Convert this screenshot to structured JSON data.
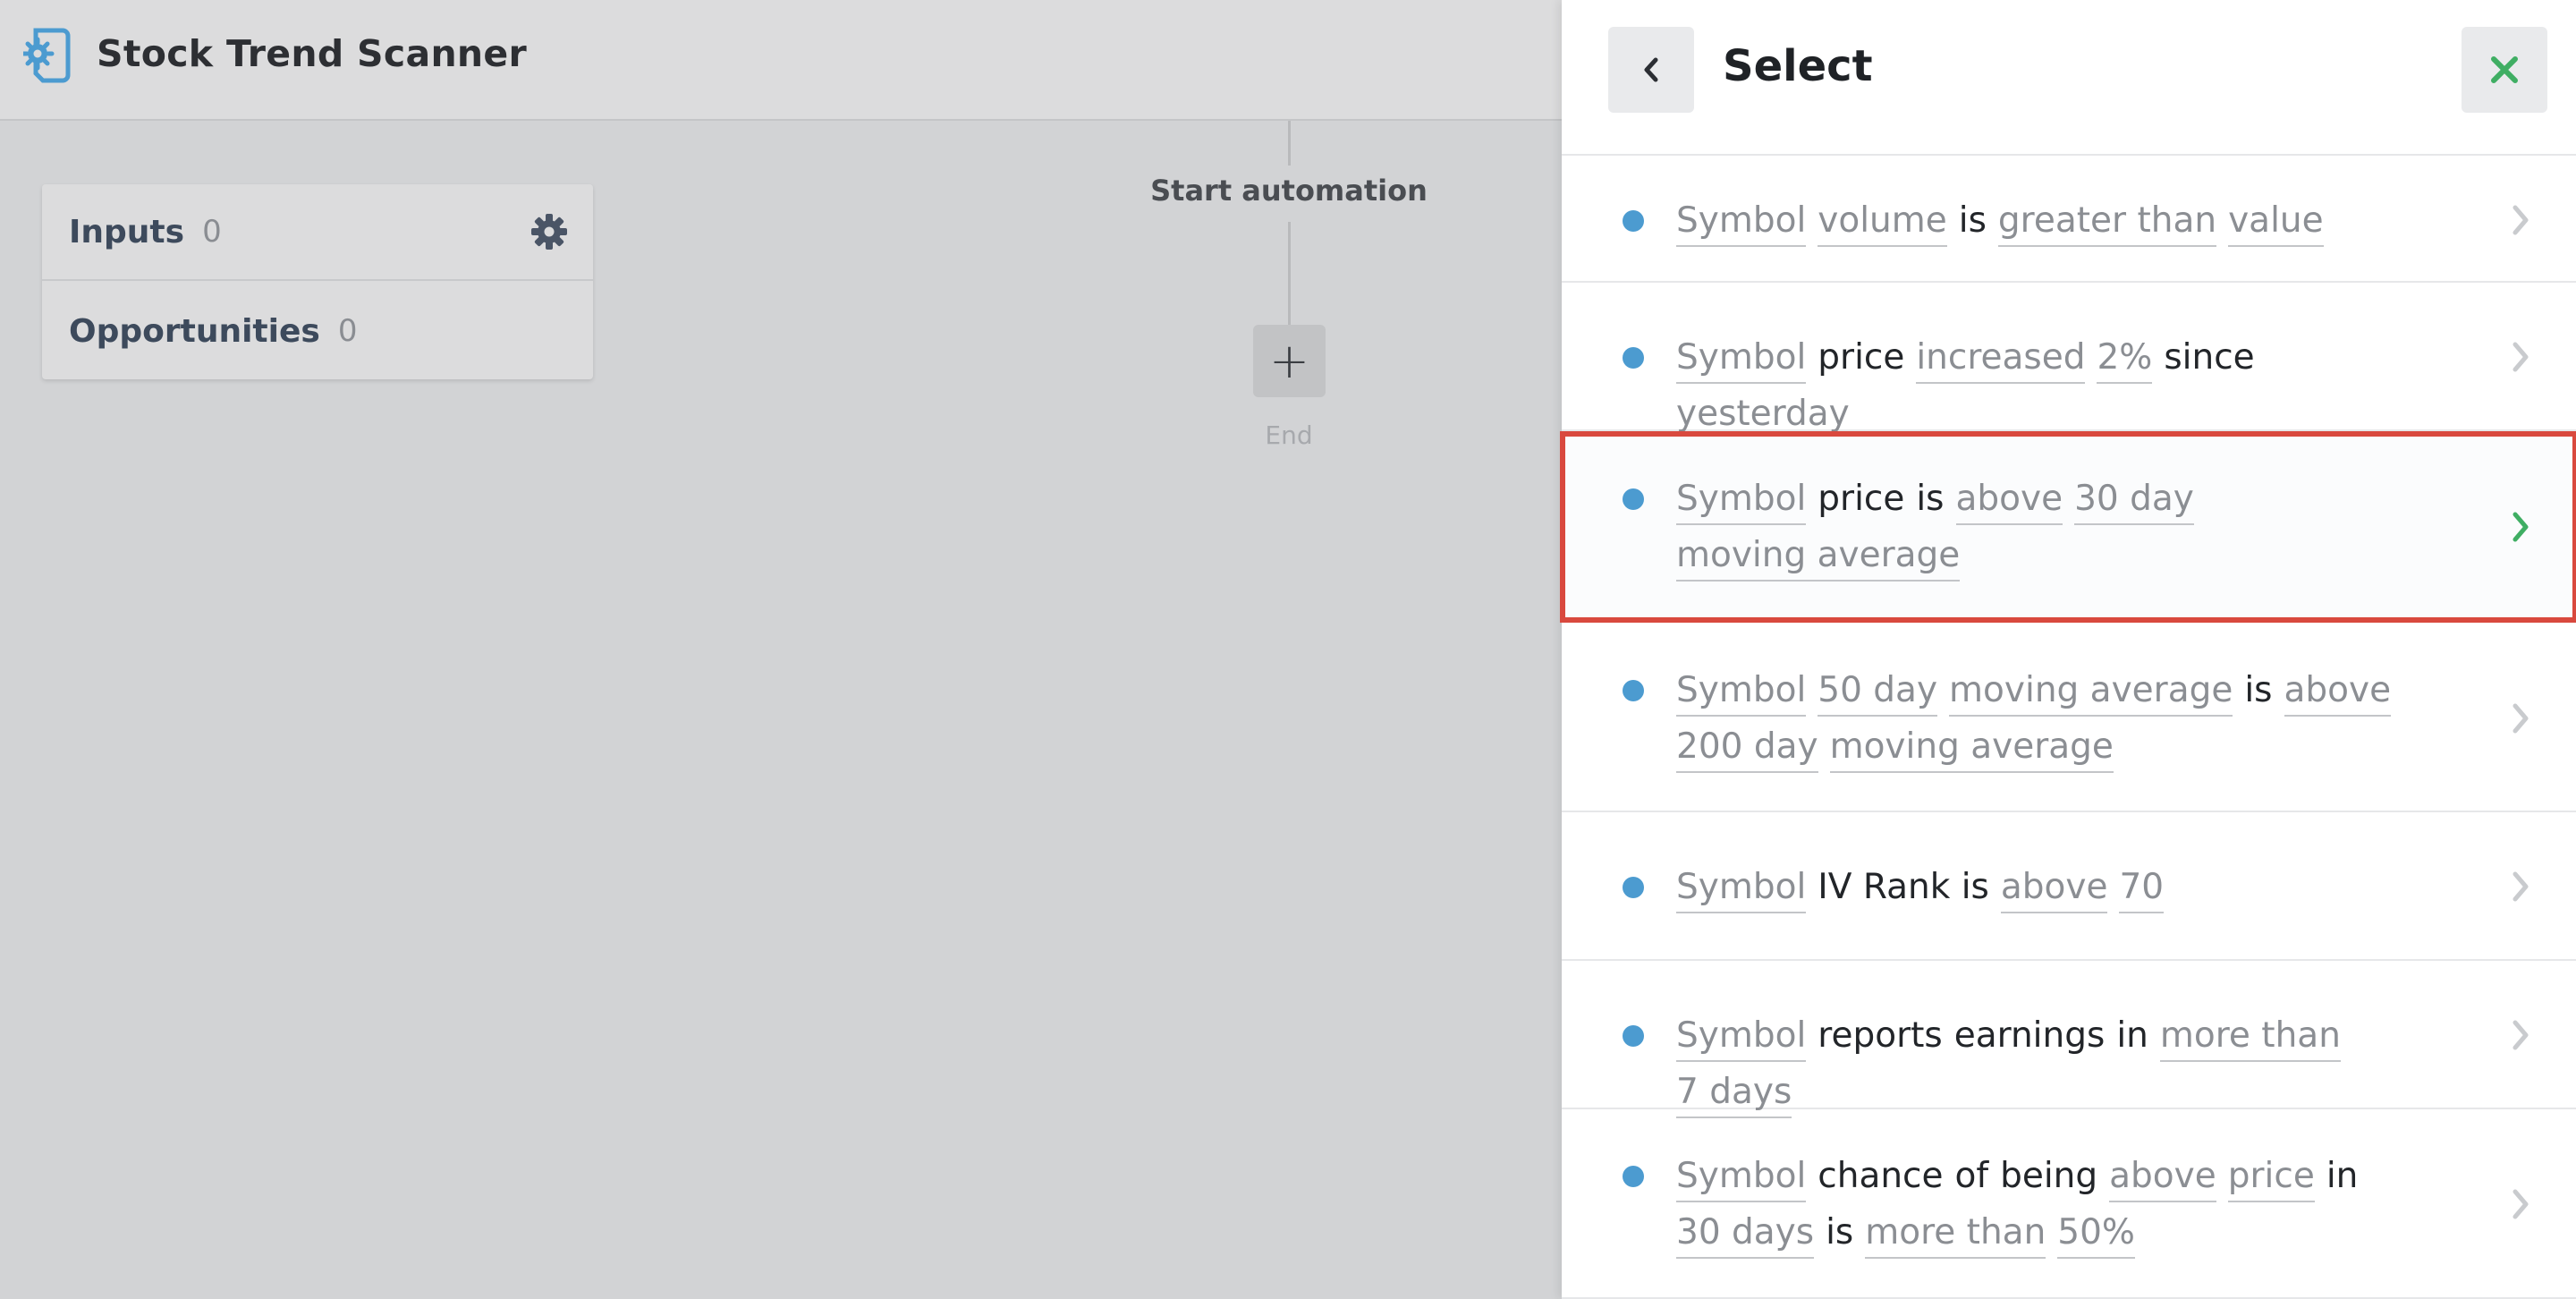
{
  "app": {
    "title": "Stock Trend Scanner"
  },
  "card": {
    "inputs_label": "Inputs",
    "inputs_count": "0",
    "opportunities_label": "Opportunities",
    "opportunities_count": "0"
  },
  "flow": {
    "start_label": "Start automation",
    "add_symbol": "+",
    "end_label": "End"
  },
  "panel": {
    "title": "Select",
    "items": [
      {
        "parts": [
          {
            "t": "Symbol",
            "k": "tok"
          },
          {
            "t": "volume",
            "k": "tok"
          },
          {
            "t": "is",
            "k": "w"
          },
          {
            "t": "greater than",
            "k": "tok"
          },
          {
            "t": "value",
            "k": "tok"
          }
        ]
      },
      {
        "parts": [
          {
            "t": "Symbol",
            "k": "tok"
          },
          {
            "t": "price",
            "k": "w"
          },
          {
            "t": "increased",
            "k": "tok"
          },
          {
            "t": "2%",
            "k": "tok"
          },
          {
            "t": "since",
            "k": "w"
          },
          {
            "t": "yesterday",
            "k": "tok"
          }
        ]
      },
      {
        "parts": [
          {
            "t": "Symbol",
            "k": "tok"
          },
          {
            "t": "price",
            "k": "w"
          },
          {
            "t": "is",
            "k": "w"
          },
          {
            "t": "above",
            "k": "tok"
          },
          {
            "t": "30 day",
            "k": "tok"
          },
          {
            "t": "moving average",
            "k": "tok"
          }
        ],
        "highlighted": true
      },
      {
        "parts": [
          {
            "t": "Symbol",
            "k": "tok"
          },
          {
            "t": "50 day",
            "k": "tok"
          },
          {
            "t": "moving average",
            "k": "tok"
          },
          {
            "t": "is",
            "k": "w"
          },
          {
            "t": "above",
            "k": "tok"
          },
          {
            "t": "200 day",
            "k": "tok"
          },
          {
            "t": "moving average",
            "k": "tok"
          }
        ]
      },
      {
        "parts": [
          {
            "t": "Symbol",
            "k": "tok"
          },
          {
            "t": "IV Rank is",
            "k": "w"
          },
          {
            "t": "above",
            "k": "tok"
          },
          {
            "t": "70",
            "k": "tok"
          }
        ]
      },
      {
        "parts": [
          {
            "t": "Symbol",
            "k": "tok"
          },
          {
            "t": "reports",
            "k": "w"
          },
          {
            "t": "earnings",
            "k": "w"
          },
          {
            "t": "in",
            "k": "w"
          },
          {
            "t": "more than",
            "k": "tok"
          },
          {
            "t": "7 days",
            "k": "tok"
          }
        ]
      },
      {
        "parts": [
          {
            "t": "Symbol",
            "k": "tok"
          },
          {
            "t": "chance",
            "k": "w"
          },
          {
            "t": "of",
            "k": "w"
          },
          {
            "t": "being",
            "k": "w"
          },
          {
            "t": "above",
            "k": "tok"
          },
          {
            "t": "price",
            "k": "tok"
          },
          {
            "t": "in",
            "k": "w"
          },
          {
            "t": "30 days",
            "k": "tok"
          },
          {
            "t": "is",
            "k": "w"
          },
          {
            "t": "more than",
            "k": "tok"
          },
          {
            "t": "50%",
            "k": "tok"
          }
        ]
      }
    ]
  },
  "colors": {
    "accent_blue": "#4c9bd0",
    "highlight_border": "#d9493e",
    "close_green": "#3fae63",
    "chevron_active": "#3fae63",
    "chevron_default": "#c9cbce"
  },
  "icons": {
    "app": "gear-document-icon",
    "settings": "gear-icon",
    "back": "chevron-left-icon",
    "close": "close-icon",
    "item_arrow": "chevron-right-icon"
  }
}
